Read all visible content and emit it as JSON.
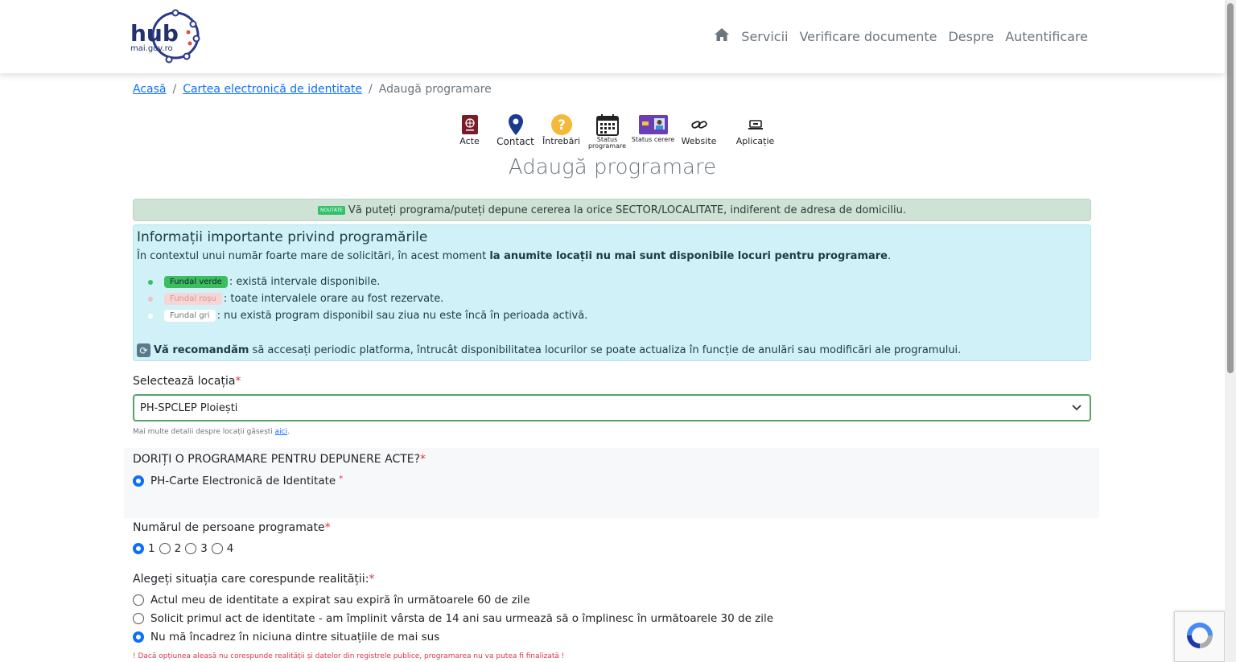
{
  "header": {
    "logo_main": "hub",
    "logo_sub": "mai.gov.ro",
    "nav": [
      "Servicii",
      "Verificare documente",
      "Despre",
      "Autentificare"
    ]
  },
  "breadcrumb": {
    "home": "Acasă",
    "parent": "Cartea electronică de identitate",
    "current": "Adaugă programare",
    "sep": "/"
  },
  "quicklinks": {
    "acte": "Acte",
    "contact": "Contact",
    "intrebari": "Întrebări",
    "status_programare": "Status programare",
    "status_cerere": "Status cerere",
    "website": "Website",
    "aplicatie": "Aplicație"
  },
  "title": "Adaugă programare",
  "notice": {
    "badge": "NOUTATE",
    "text": "Vă puteți programa/puteți depune cererea la orice SECTOR/LOCALITATE, indiferent de adresa de domiciliu."
  },
  "info": {
    "heading": "Informații importante privind programările",
    "intro": "În contextul unui număr foarte mare de solicitări, în acest moment ",
    "intro_bold": "la anumite locații nu mai sunt disponibile locuri pentru programare",
    "intro_end": ".",
    "legend": [
      {
        "pill": "Fundal verde",
        "text": ": există intervale disponibile."
      },
      {
        "pill": "Fundal roșu",
        "text": ": toate intervalele orare au fost rezervate."
      },
      {
        "pill": "Fundal gri",
        "text": ": nu există program disponibil sau ziua nu este încă în perioada activă."
      }
    ],
    "recommend_bold": "Vă recomandăm",
    "recommend_text": " să accesați periodic platforma, întrucât disponibilitatea locurilor se poate actualiza în funcție de anulări sau modificări ale programului."
  },
  "location": {
    "label": "Selectează locația",
    "value": "PH-SPCLEP Ploiești",
    "hint": "Mai multe detalii despre locații găsești ",
    "hint_link": "aici",
    "hint_end": "."
  },
  "depunere": {
    "label": "DORIȚI O PROGRAMARE PENTRU DEPUNERE ACTE?",
    "option": "PH-Carte Electronică de Identitate"
  },
  "persons": {
    "label": "Numărul de persoane programate",
    "options": [
      "1",
      "2",
      "3",
      "4"
    ],
    "selected": "1"
  },
  "situation": {
    "label": "Alegeți situația care corespunde realității:",
    "options": [
      "Actul meu de identitate a expirat sau expiră în următoarele 60 de zile",
      "Solicit primul act de identitate - am împlinit vârsta de 14 ani sau urmează să o împlinesc în următoarele 30 de zile",
      "Nu mă încadrez în niciuna dintre situațiile de mai sus"
    ],
    "selected_index": 2,
    "warning": "! Dacă opțiunea aleasă nu corespunde realității și datelor din registrele publice, programarea nu va putea fi finalizată !"
  },
  "required_mark": "*"
}
